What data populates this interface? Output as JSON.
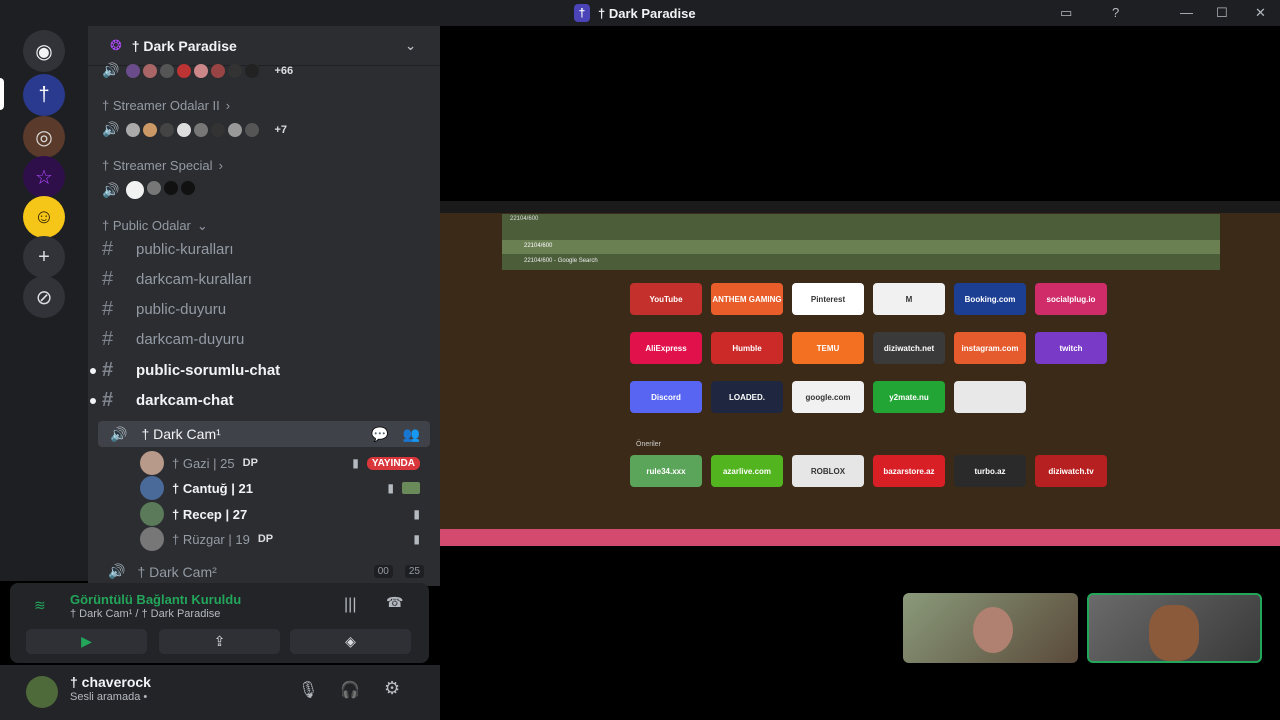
{
  "window": {
    "title": "† Dark Paradise"
  },
  "server": {
    "name": "† Dark Paradise"
  },
  "voice_top": {
    "extra_count": "+66"
  },
  "categories": {
    "streamer_odalar": "† Streamer Odalar II",
    "streamer_special": "† Streamer Special",
    "public_odalar": "† Public Odalar"
  },
  "streamer_odalar_extra": "+7",
  "channels": [
    {
      "name": "public-kuralları",
      "unread": false
    },
    {
      "name": "darkcam-kuralları",
      "unread": false
    },
    {
      "name": "public-duyuru",
      "unread": false
    },
    {
      "name": "darkcam-duyuru",
      "unread": false
    },
    {
      "name": "public-sorumlu-chat",
      "unread": true
    },
    {
      "name": "darkcam-chat",
      "unread": true
    }
  ],
  "active_voice": {
    "name": "† Dark Cam¹",
    "users": [
      {
        "name": "† Gazi | 25",
        "tag": "DP",
        "live": "YAYINDA"
      },
      {
        "name": "† Cantuğ | 21"
      },
      {
        "name": "† Recep | 27"
      },
      {
        "name": "† Rüzgar | 19",
        "tag": "DP"
      }
    ]
  },
  "second_voice": {
    "name": "† Dark Cam²",
    "count_a": "00",
    "count_b": "25"
  },
  "rtc": {
    "status": "Görüntülü Bağlantı Kuruldu",
    "location": "† Dark Cam¹ / † Dark Paradise"
  },
  "user": {
    "name": "† chaverock",
    "status": "Sesli aramada •"
  },
  "stream": {
    "address_text": "22104/600",
    "suggestion_1": "22104/600",
    "suggestion_2": "22104/600 - Google Search",
    "tiles": [
      {
        "label": "YouTube",
        "color": "#c4302b"
      },
      {
        "label": "ANTHEM GAMING",
        "color": "#e85d2a"
      },
      {
        "label": "Pinterest",
        "color": "#ffffff"
      },
      {
        "label": "M",
        "color": "#f1f1f1"
      },
      {
        "label": "Booking.com",
        "color": "#1c3f94"
      },
      {
        "label": "socialplug.io",
        "color": "#d02c6a"
      },
      {
        "label": "AliExpress",
        "color": "#e0114b"
      },
      {
        "label": "Humble",
        "color": "#cc2929"
      },
      {
        "label": "TEMU",
        "color": "#f36f21"
      },
      {
        "label": "diziwatch.net",
        "color": "#3a3a3a"
      },
      {
        "label": "instagram.com",
        "color": "#e55b2d"
      },
      {
        "label": "twitch",
        "color": "#7a3ac8"
      },
      {
        "label": "Discord",
        "color": "#5865f2"
      },
      {
        "label": "LOADED.",
        "color": "#1f2740"
      },
      {
        "label": "google.com",
        "color": "#f1f1f1"
      },
      {
        "label": "y2mate.nu",
        "color": "#23a536"
      },
      {
        "label": "",
        "color": "#e8e8e8"
      },
      {
        "label": "rule34.xxx",
        "color": "#5aa55a"
      },
      {
        "label": "azarlive.com",
        "color": "#52b520"
      },
      {
        "label": "ROBLOX",
        "color": "#e6e6e6"
      },
      {
        "label": "bazarstore.az",
        "color": "#d81f26"
      },
      {
        "label": "turbo.az",
        "color": "#2a2a2a"
      },
      {
        "label": "diziwatch.tv",
        "color": "#b72020"
      }
    ],
    "section_label": "Öneriler"
  }
}
